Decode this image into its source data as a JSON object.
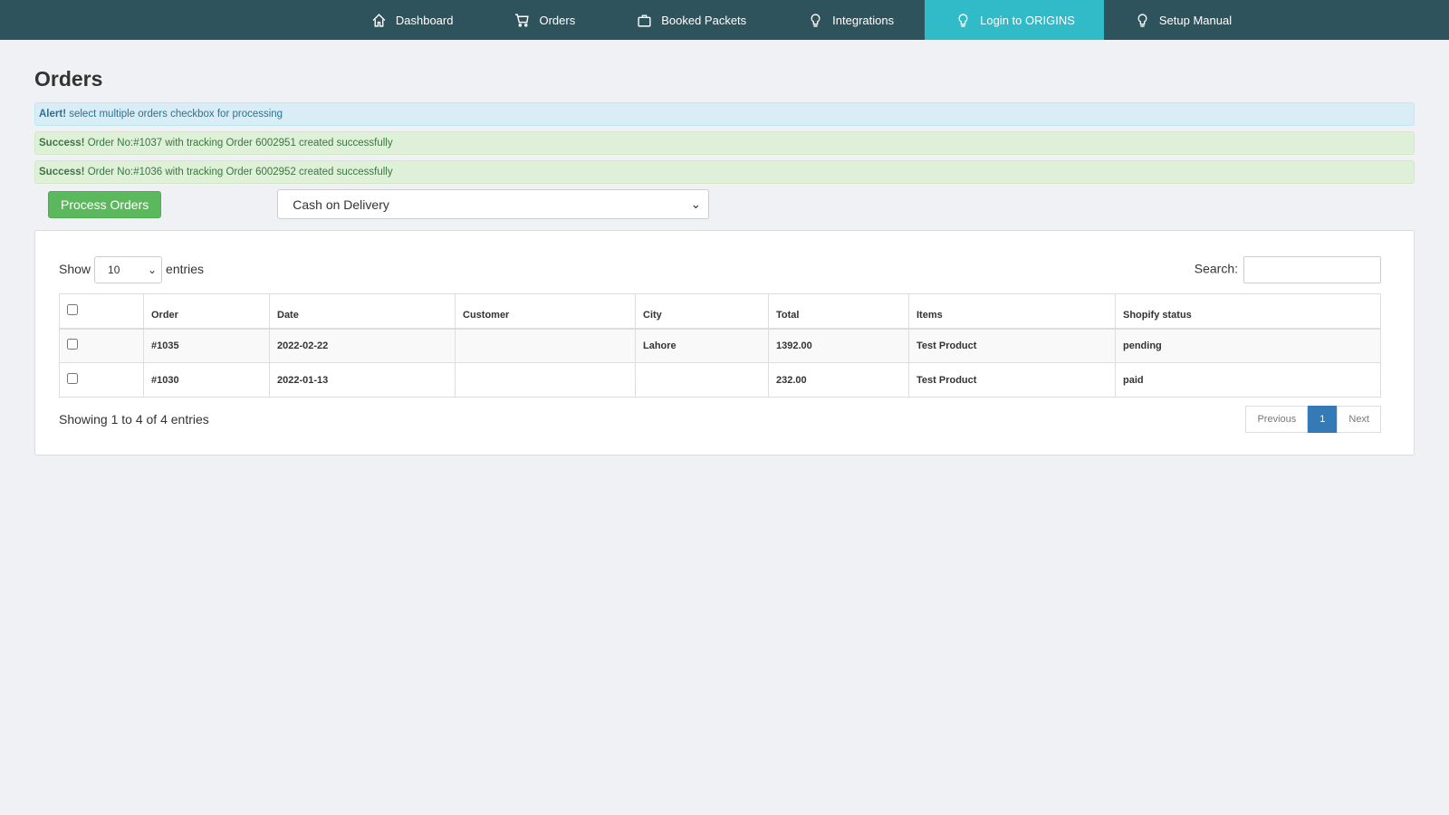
{
  "nav": [
    {
      "label": "Dashboard",
      "icon": "home-icon"
    },
    {
      "label": "Orders",
      "icon": "cart-icon"
    },
    {
      "label": "Booked Packets",
      "icon": "bag-icon"
    },
    {
      "label": "Integrations",
      "icon": "bulb-icon"
    },
    {
      "label": "Login to ORIGINS",
      "icon": "bulb-icon",
      "active": true
    },
    {
      "label": "Setup Manual",
      "icon": "bulb-icon"
    }
  ],
  "page_title": "Orders",
  "alerts": [
    {
      "strong": "Alert!",
      "text": " select multiple orders checkbox for processing"
    },
    {
      "strong": "Success!",
      "text": " Order No:#1037 with tracking Order 6002951 created successfully"
    },
    {
      "strong": "Success!",
      "text": " Order No:#1036 with tracking Order 6002952 created successfully"
    }
  ],
  "process_button": "Process Orders",
  "payment_select": "Cash on Delivery",
  "table": {
    "show_label": "Show",
    "entries_value": "10",
    "entries_label": "entries",
    "search_label": "Search:",
    "search_value": "",
    "columns": [
      "Order",
      "Date",
      "Customer",
      "City",
      "Total",
      "Items",
      "Shopify status"
    ],
    "rows": [
      [
        "#1035",
        "2022-02-22",
        "",
        "Lahore",
        "1392.00",
        "Test Product",
        "pending"
      ],
      [
        "#1030",
        "2022-01-13",
        "",
        "",
        "232.00",
        "Test Product",
        "paid"
      ]
    ],
    "info": "Showing 1 to 4 of 4 entries",
    "prev": "Previous",
    "page": "1",
    "next": "Next"
  },
  "colors": {
    "nav": "#2f535c",
    "nav_active": "#31bac7",
    "button": "#5cb85c",
    "page_active": "#337ab7"
  }
}
